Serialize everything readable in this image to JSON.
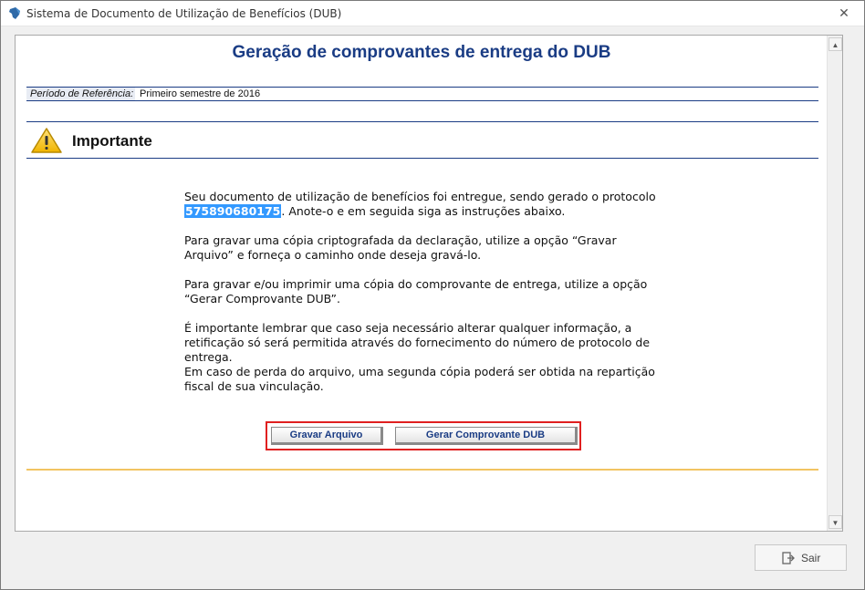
{
  "window": {
    "title": "Sistema de Documento de Utilização de Benefícios (DUB)",
    "close_glyph": "✕"
  },
  "page": {
    "title": "Geração de comprovantes de entrega do DUB",
    "period_label": "Período de Referência:",
    "period_value": "Primeiro semestre de 2016",
    "important_heading": "Importante"
  },
  "message": {
    "p1_before": "Seu documento de utilização de benefícios foi entregue, sendo gerado o protocolo",
    "protocol": "575890680175",
    "p1_after": ". Anote-o e em seguida siga as instruções abaixo.",
    "p2": "Para gravar uma cópia criptografada da declaração, utilize a opção “Gravar Arquivo” e forneça o caminho onde deseja gravá-lo.",
    "p3": "Para gravar e/ou imprimir uma cópia do comprovante de entrega, utilize a opção “Gerar Comprovante DUB”.",
    "p4": "É importante lembrar que caso seja necessário alterar qualquer informação, a retificação só será permitida através do fornecimento do número de protocolo de entrega.",
    "p5": "Em caso de perda do arquivo, uma segunda cópia poderá ser obtida na repartição fiscal de sua vinculação."
  },
  "buttons": {
    "gravar": "Gravar Arquivo",
    "gerar": "Gerar Comprovante DUB",
    "sair": "Sair"
  },
  "icons": {
    "app": "brazil-map-icon",
    "warning": "warning-triangle-icon",
    "exit": "exit-door-icon"
  },
  "colors": {
    "title_blue": "#1a3c84",
    "protocol_highlight": "#3399ff",
    "highlight_box": "#e02020",
    "separator_orange": "#f2c462"
  }
}
